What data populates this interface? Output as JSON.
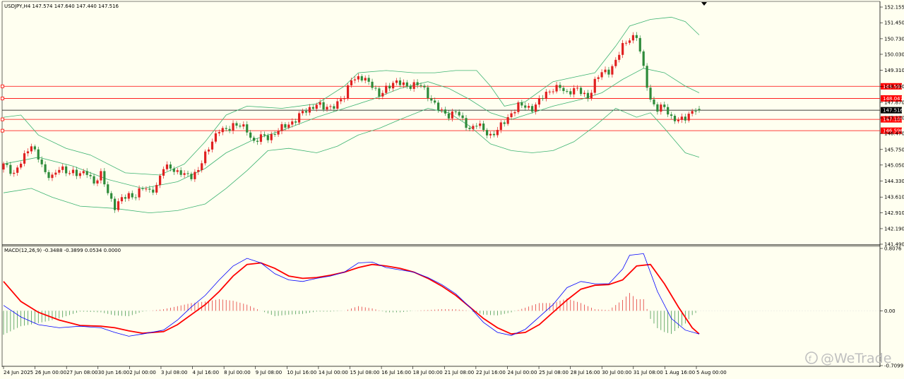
{
  "price_pane": {
    "header": "USDJPY,H4  147.574 147.640 147.440 147.516",
    "price_ticks": [
      "152.155",
      "151.450",
      "150.730",
      "150.030",
      "149.310",
      "148.590",
      "147.870",
      "147.170",
      "146.470",
      "145.750",
      "145.050",
      "144.330",
      "143.610",
      "142.910",
      "142.190",
      "141.490"
    ],
    "current_price": "147.516",
    "levels": [
      {
        "label": "148.591",
        "value": 148.591
      },
      {
        "label": "148.047",
        "value": 148.047
      },
      {
        "label": "147.105",
        "value": 147.105
      },
      {
        "label": "146.596",
        "value": 146.596
      }
    ]
  },
  "macd_pane": {
    "header": "MACD(12,26,9) -0.3488 -0.3899 0.0534 0.0000",
    "ticks": [
      "0.8076",
      "0.00",
      "-0.7099"
    ]
  },
  "time_axis": {
    "labels": [
      "24 Jun 2025",
      "26 Jun 00:00",
      "27 Jun 08:00",
      "30 Jun 16:00",
      "2 Jul 00:00",
      "3 Jul 08:00",
      "4 Jul 16:00",
      "8 Jul 00:00",
      "9 Jul 08:00",
      "10 Jul 16:00",
      "14 Jul 00:00",
      "15 Jul 08:00",
      "16 Jul 16:00",
      "18 Jul 00:00",
      "21 Jul 08:00",
      "22 Jul 16:00",
      "24 Jul 00:00",
      "25 Jul 08:00",
      "28 Jul 16:00",
      "30 Jul 00:00",
      "31 Jul 08:00",
      "1 Aug 16:00",
      "5 Aug 00:00"
    ]
  },
  "watermark": "@WeTrade",
  "colors": {
    "background": "#fffff0",
    "bull": "#e02020",
    "bear": "#2e8b3a",
    "bands": "#3cb371",
    "macd_line": "#0000ff",
    "signal_line": "#ff0000",
    "level": "#ff0000"
  },
  "chart_data": {
    "type": "candlestick",
    "symbol": "USDJPY",
    "timeframe": "H4",
    "ohlc_last": {
      "open": 147.574,
      "high": 147.64,
      "low": 147.44,
      "close": 147.516
    },
    "ylim": [
      141.49,
      152.155
    ],
    "horizontal_levels": [
      148.591,
      148.047,
      147.105,
      146.596
    ],
    "close_path": [
      [
        0,
        145.05
      ],
      [
        3,
        144.7
      ],
      [
        6,
        145.4
      ],
      [
        8,
        146.0
      ],
      [
        10,
        145.4
      ],
      [
        12,
        144.6
      ],
      [
        14,
        144.6
      ],
      [
        16,
        144.9
      ],
      [
        18,
        144.7
      ],
      [
        20,
        144.8
      ],
      [
        22,
        144.6
      ],
      [
        24,
        144.7
      ],
      [
        26,
        144.3
      ],
      [
        28,
        144.6
      ],
      [
        30,
        143.8
      ],
      [
        32,
        143.2
      ],
      [
        34,
        143.5
      ],
      [
        36,
        143.7
      ],
      [
        38,
        143.7
      ],
      [
        40,
        144.0
      ],
      [
        42,
        143.9
      ],
      [
        44,
        144.1
      ],
      [
        46,
        144.9
      ],
      [
        48,
        145.0
      ],
      [
        50,
        144.7
      ],
      [
        52,
        144.6
      ],
      [
        54,
        144.6
      ],
      [
        56,
        144.8
      ],
      [
        58,
        145.5
      ],
      [
        60,
        146.2
      ],
      [
        62,
        146.6
      ],
      [
        64,
        146.6
      ],
      [
        66,
        146.9
      ],
      [
        68,
        146.8
      ],
      [
        70,
        146.6
      ],
      [
        72,
        146.1
      ],
      [
        74,
        146.3
      ],
      [
        76,
        146.3
      ],
      [
        78,
        146.5
      ],
      [
        80,
        146.7
      ],
      [
        82,
        146.9
      ],
      [
        84,
        147.1
      ],
      [
        86,
        147.4
      ],
      [
        88,
        147.6
      ],
      [
        90,
        147.8
      ],
      [
        92,
        147.6
      ],
      [
        94,
        147.7
      ],
      [
        96,
        147.8
      ],
      [
        98,
        148.1
      ],
      [
        100,
        149.0
      ],
      [
        102,
        148.9
      ],
      [
        104,
        148.9
      ],
      [
        106,
        148.7
      ],
      [
        108,
        148.1
      ],
      [
        110,
        148.5
      ],
      [
        112,
        148.8
      ],
      [
        114,
        148.7
      ],
      [
        116,
        148.6
      ],
      [
        118,
        148.7
      ],
      [
        120,
        148.6
      ],
      [
        122,
        148.2
      ],
      [
        124,
        147.8
      ],
      [
        126,
        147.4
      ],
      [
        128,
        147.3
      ],
      [
        130,
        147.5
      ],
      [
        132,
        147.0
      ],
      [
        134,
        146.7
      ],
      [
        136,
        146.9
      ],
      [
        138,
        146.6
      ],
      [
        140,
        146.4
      ],
      [
        142,
        146.6
      ],
      [
        144,
        147.0
      ],
      [
        146,
        147.4
      ],
      [
        148,
        147.7
      ],
      [
        150,
        147.7
      ],
      [
        152,
        147.6
      ],
      [
        154,
        147.9
      ],
      [
        156,
        148.3
      ],
      [
        158,
        148.5
      ],
      [
        160,
        148.5
      ],
      [
        162,
        148.3
      ],
      [
        164,
        148.5
      ],
      [
        166,
        148.3
      ],
      [
        168,
        148.1
      ],
      [
        170,
        148.8
      ],
      [
        172,
        149.2
      ],
      [
        174,
        149.3
      ],
      [
        176,
        149.7
      ],
      [
        178,
        150.4
      ],
      [
        180,
        150.8
      ],
      [
        182,
        150.8
      ],
      [
        184,
        149.4
      ],
      [
        186,
        148.0
      ],
      [
        188,
        147.5
      ],
      [
        190,
        147.7
      ],
      [
        192,
        147.2
      ],
      [
        194,
        147.0
      ],
      [
        196,
        147.2
      ],
      [
        198,
        147.5
      ],
      [
        200,
        147.516
      ]
    ],
    "bollinger": {
      "upper": [
        [
          0,
          147.2
        ],
        [
          5,
          147.3
        ],
        [
          10,
          146.4
        ],
        [
          18,
          145.8
        ],
        [
          25,
          145.5
        ],
        [
          35,
          144.7
        ],
        [
          45,
          144.6
        ],
        [
          52,
          145.1
        ],
        [
          58,
          146.1
        ],
        [
          64,
          147.3
        ],
        [
          70,
          147.7
        ],
        [
          80,
          147.6
        ],
        [
          90,
          147.8
        ],
        [
          98,
          148.6
        ],
        [
          102,
          149.2
        ],
        [
          110,
          149.3
        ],
        [
          118,
          149.2
        ],
        [
          124,
          149.2
        ],
        [
          130,
          149.3
        ],
        [
          136,
          149.3
        ],
        [
          140,
          148.6
        ],
        [
          144,
          147.7
        ],
        [
          150,
          147.9
        ],
        [
          158,
          148.8
        ],
        [
          164,
          149.0
        ],
        [
          170,
          149.2
        ],
        [
          176,
          150.4
        ],
        [
          180,
          151.3
        ],
        [
          186,
          151.6
        ],
        [
          192,
          151.7
        ],
        [
          196,
          151.5
        ],
        [
          200,
          150.9
        ]
      ],
      "middle": [
        [
          0,
          145.1
        ],
        [
          10,
          145.4
        ],
        [
          20,
          145.0
        ],
        [
          30,
          144.4
        ],
        [
          40,
          144.0
        ],
        [
          50,
          144.3
        ],
        [
          58,
          144.9
        ],
        [
          64,
          145.6
        ],
        [
          72,
          146.2
        ],
        [
          80,
          146.6
        ],
        [
          90,
          147.2
        ],
        [
          98,
          147.6
        ],
        [
          106,
          148.0
        ],
        [
          114,
          148.5
        ],
        [
          122,
          148.8
        ],
        [
          128,
          148.5
        ],
        [
          134,
          148.0
        ],
        [
          140,
          147.4
        ],
        [
          146,
          147.1
        ],
        [
          152,
          147.4
        ],
        [
          158,
          147.7
        ],
        [
          166,
          148.0
        ],
        [
          172,
          148.3
        ],
        [
          178,
          148.9
        ],
        [
          184,
          149.4
        ],
        [
          190,
          149.2
        ],
        [
          196,
          148.6
        ],
        [
          200,
          148.3
        ]
      ],
      "lower": [
        [
          0,
          143.8
        ],
        [
          8,
          144.0
        ],
        [
          14,
          143.6
        ],
        [
          22,
          143.2
        ],
        [
          32,
          143.1
        ],
        [
          42,
          142.9
        ],
        [
          50,
          143.0
        ],
        [
          58,
          143.3
        ],
        [
          64,
          144.0
        ],
        [
          70,
          144.8
        ],
        [
          76,
          145.7
        ],
        [
          82,
          145.8
        ],
        [
          90,
          145.6
        ],
        [
          96,
          145.9
        ],
        [
          102,
          146.4
        ],
        [
          108,
          146.7
        ],
        [
          114,
          147.1
        ],
        [
          122,
          147.6
        ],
        [
          128,
          147.4
        ],
        [
          134,
          146.8
        ],
        [
          140,
          146.0
        ],
        [
          146,
          145.7
        ],
        [
          152,
          145.6
        ],
        [
          158,
          145.7
        ],
        [
          164,
          146.1
        ],
        [
          170,
          146.8
        ],
        [
          176,
          147.6
        ],
        [
          182,
          147.2
        ],
        [
          186,
          147.4
        ],
        [
          190,
          146.7
        ],
        [
          196,
          145.6
        ],
        [
          200,
          145.4
        ]
      ]
    },
    "macd": {
      "ylim": [
        -0.7099,
        0.8076
      ],
      "macd_line": [
        [
          0,
          0.07
        ],
        [
          5,
          -0.08
        ],
        [
          10,
          -0.18
        ],
        [
          16,
          -0.22
        ],
        [
          22,
          -0.2
        ],
        [
          28,
          -0.22
        ],
        [
          32,
          -0.28
        ],
        [
          36,
          -0.33
        ],
        [
          40,
          -0.3
        ],
        [
          46,
          -0.25
        ],
        [
          50,
          -0.12
        ],
        [
          54,
          0.05
        ],
        [
          58,
          0.2
        ],
        [
          62,
          0.4
        ],
        [
          66,
          0.58
        ],
        [
          70,
          0.68
        ],
        [
          74,
          0.62
        ],
        [
          78,
          0.48
        ],
        [
          82,
          0.4
        ],
        [
          86,
          0.38
        ],
        [
          90,
          0.42
        ],
        [
          94,
          0.45
        ],
        [
          98,
          0.5
        ],
        [
          102,
          0.62
        ],
        [
          106,
          0.63
        ],
        [
          110,
          0.56
        ],
        [
          114,
          0.53
        ],
        [
          118,
          0.5
        ],
        [
          122,
          0.43
        ],
        [
          126,
          0.34
        ],
        [
          130,
          0.22
        ],
        [
          134,
          0.05
        ],
        [
          138,
          -0.15
        ],
        [
          142,
          -0.28
        ],
        [
          146,
          -0.32
        ],
        [
          150,
          -0.24
        ],
        [
          154,
          -0.08
        ],
        [
          158,
          0.08
        ],
        [
          162,
          0.3
        ],
        [
          166,
          0.38
        ],
        [
          170,
          0.35
        ],
        [
          174,
          0.35
        ],
        [
          178,
          0.54
        ],
        [
          180,
          0.72
        ],
        [
          184,
          0.74
        ],
        [
          188,
          0.25
        ],
        [
          192,
          -0.1
        ],
        [
          196,
          -0.25
        ],
        [
          200,
          -0.3
        ]
      ],
      "signal_line": [
        [
          0,
          0.38
        ],
        [
          5,
          0.12
        ],
        [
          10,
          -0.02
        ],
        [
          16,
          -0.12
        ],
        [
          22,
          -0.19
        ],
        [
          28,
          -0.2
        ],
        [
          32,
          -0.22
        ],
        [
          36,
          -0.26
        ],
        [
          40,
          -0.29
        ],
        [
          46,
          -0.27
        ],
        [
          50,
          -0.18
        ],
        [
          54,
          -0.05
        ],
        [
          58,
          0.08
        ],
        [
          62,
          0.25
        ],
        [
          66,
          0.45
        ],
        [
          70,
          0.6
        ],
        [
          74,
          0.62
        ],
        [
          78,
          0.55
        ],
        [
          82,
          0.45
        ],
        [
          86,
          0.42
        ],
        [
          90,
          0.43
        ],
        [
          94,
          0.46
        ],
        [
          98,
          0.5
        ],
        [
          102,
          0.56
        ],
        [
          106,
          0.6
        ],
        [
          110,
          0.58
        ],
        [
          114,
          0.55
        ],
        [
          118,
          0.5
        ],
        [
          122,
          0.42
        ],
        [
          126,
          0.32
        ],
        [
          130,
          0.2
        ],
        [
          134,
          0.05
        ],
        [
          138,
          -0.1
        ],
        [
          142,
          -0.22
        ],
        [
          146,
          -0.3
        ],
        [
          150,
          -0.28
        ],
        [
          154,
          -0.18
        ],
        [
          158,
          -0.02
        ],
        [
          162,
          0.14
        ],
        [
          166,
          0.28
        ],
        [
          170,
          0.33
        ],
        [
          174,
          0.34
        ],
        [
          178,
          0.4
        ],
        [
          182,
          0.58
        ],
        [
          186,
          0.6
        ],
        [
          190,
          0.35
        ],
        [
          194,
          0.05
        ],
        [
          198,
          -0.22
        ],
        [
          200,
          -0.3
        ]
      ]
    }
  }
}
